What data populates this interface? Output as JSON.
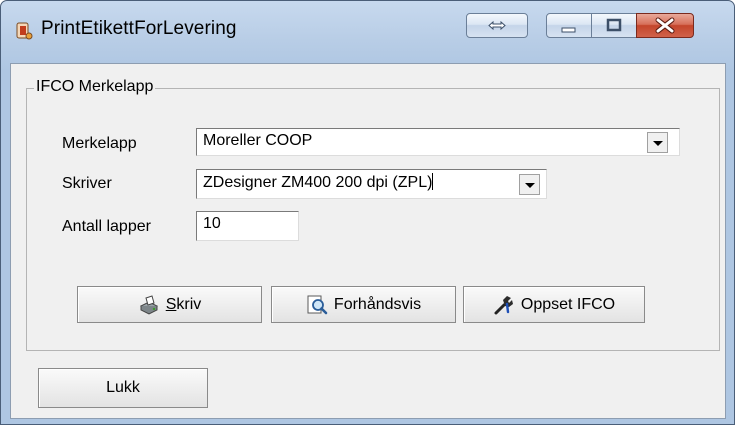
{
  "window": {
    "title": "PrintEtikettForLevering",
    "icons": {
      "app": "printer-icon",
      "resize": "resize-arrows-icon",
      "minimize": "minimize-icon",
      "maximize": "maximize-icon",
      "close": "close-icon"
    }
  },
  "group": {
    "title": "IFCO Merkelapp",
    "merkelapp": {
      "label": "Merkelapp",
      "value": "Moreller COOP"
    },
    "skriver": {
      "label": "Skriver",
      "value": "ZDesigner ZM400 200 dpi (ZPL)"
    },
    "antall": {
      "label": "Antall lapper",
      "value": "10"
    }
  },
  "buttons": {
    "skriv": {
      "mnemonic": "S",
      "rest": "kriv",
      "icon": "printer-icon"
    },
    "forhandsvis": {
      "label": "Forhåndsvis",
      "icon": "magnifier-icon"
    },
    "oppset": {
      "label": "Oppset IFCO",
      "icon": "wrench-icon"
    },
    "lukk": {
      "label": "Lukk"
    }
  },
  "colors": {
    "titlebar": "#b8cde6",
    "close": "#c4452b",
    "face": "#f0f0f0"
  }
}
